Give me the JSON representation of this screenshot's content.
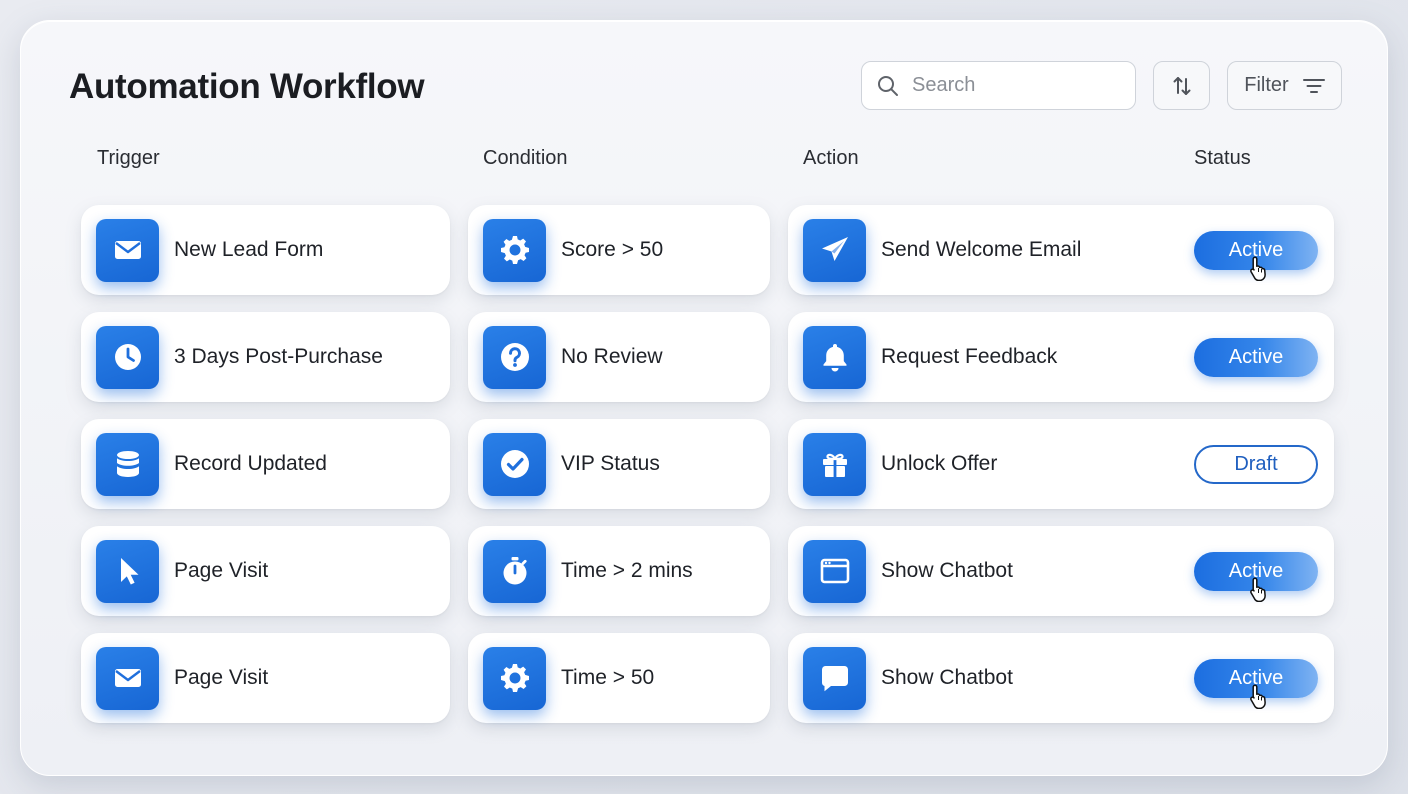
{
  "header": {
    "title": "Automation Workflow",
    "search_placeholder": "Search",
    "filter_label": "Filter"
  },
  "columns": {
    "trigger": "Trigger",
    "condition": "Condition",
    "action": "Action",
    "status": "Status"
  },
  "colors": {
    "accent": "#1f6fdc",
    "draft_border": "#2468c9"
  },
  "rows": [
    {
      "trigger": {
        "label": "New Lead Form",
        "icon": "envelope-icon"
      },
      "condition": {
        "label": "Score > 50",
        "icon": "gear-icon"
      },
      "action": {
        "label": "Send Welcome Email",
        "icon": "paper-plane-icon"
      },
      "status": {
        "label": "Active",
        "state": "active",
        "hover": true
      }
    },
    {
      "trigger": {
        "label": "3 Days Post-Purchase",
        "icon": "clock-icon"
      },
      "condition": {
        "label": "No Review",
        "icon": "question-icon"
      },
      "action": {
        "label": "Request Feedback",
        "icon": "bell-icon"
      },
      "status": {
        "label": "Active",
        "state": "active",
        "hover": false
      }
    },
    {
      "trigger": {
        "label": "Record Updated",
        "icon": "database-icon"
      },
      "condition": {
        "label": "VIP Status",
        "icon": "check-circle-icon"
      },
      "action": {
        "label": "Unlock Offer",
        "icon": "gift-icon"
      },
      "status": {
        "label": "Draft",
        "state": "draft",
        "hover": false
      }
    },
    {
      "trigger": {
        "label": "Page Visit",
        "icon": "pointer-icon"
      },
      "condition": {
        "label": "Time > 2 mins",
        "icon": "stopwatch-icon"
      },
      "action": {
        "label": "Show Chatbot",
        "icon": "browser-window-icon"
      },
      "status": {
        "label": "Active",
        "state": "active",
        "hover": true
      }
    },
    {
      "trigger": {
        "label": "Page Visit",
        "icon": "envelope-icon"
      },
      "condition": {
        "label": "Time > 50",
        "icon": "gear-icon"
      },
      "action": {
        "label": "Show Chatbot",
        "icon": "chat-bubble-icon"
      },
      "status": {
        "label": "Active",
        "state": "active",
        "hover": true
      }
    }
  ]
}
